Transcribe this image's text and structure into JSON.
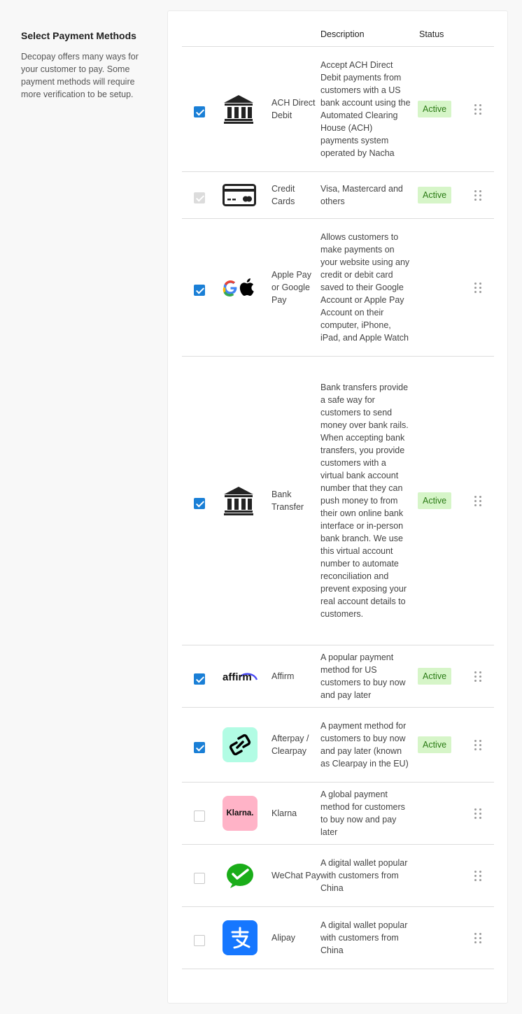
{
  "sidebar": {
    "title": "Select Payment Methods",
    "description": "Decopay offers many ways for your customer to pay. Some payment methods will require more verification to be setup."
  },
  "table": {
    "headers": {
      "description": "Description",
      "status": "Status"
    },
    "rows": [
      {
        "name": "ACH Direct Debit",
        "description": "Accept ACH Direct Debit payments from customers with a US bank account using the Automated Clearing House (ACH) payments system operated by Nacha",
        "status": "Active",
        "checked": true,
        "icon": "bank-icon"
      },
      {
        "name": "Credit Cards",
        "description": "Visa, Mastercard and others",
        "status": "Active",
        "checked": true,
        "disabled": true,
        "icon": "credit-card-icon"
      },
      {
        "name": "Apple Pay or Google Pay",
        "description": "Allows customers to make payments on your website using any credit or debit card saved to their Google Account or Apple Pay Account on their computer, iPhone, iPad, and Apple Watch",
        "status": "",
        "checked": true,
        "icon": "google-apple-icon"
      },
      {
        "name": "Bank Transfer",
        "description": "Bank transfers provide a safe way for customers to send money over bank rails. When accepting bank transfers, you provide customers with a virtual bank account number that they can push money to from their own online bank interface or in-person bank branch. We use this virtual account number to automate reconciliation and prevent exposing your real account details to customers.",
        "status": "Active",
        "checked": true,
        "icon": "bank-icon"
      },
      {
        "name": "Affirm",
        "description": "A popular payment method for US customers to buy now and pay later",
        "status": "Active",
        "checked": true,
        "icon": "affirm-logo",
        "logo_text": "affirm"
      },
      {
        "name": "Afterpay / Clearpay",
        "description": "A payment method for customers to buy now and pay later (known as Clearpay in the EU)",
        "status": "Active",
        "checked": true,
        "icon": "afterpay-logo"
      },
      {
        "name": "Klarna",
        "description": "A global payment method for customers to buy now and pay later",
        "status": "",
        "checked": false,
        "icon": "klarna-logo",
        "logo_text": "Klarna."
      },
      {
        "name": "WeChat Pay",
        "description": "A digital wallet popular with customers from China",
        "status": "",
        "checked": false,
        "icon": "wechat-pay-logo"
      },
      {
        "name": "Alipay",
        "description": "A digital wallet popular with customers from China",
        "status": "",
        "checked": false,
        "icon": "alipay-logo"
      }
    ]
  },
  "colors": {
    "accent": "#1a7fd6",
    "badge_bg": "#d6f5c8",
    "badge_text": "#2a7a14",
    "afterpay_bg": "#b2fce4",
    "klarna_bg": "#ffb3c7",
    "wechat_green": "#1aad19",
    "alipay_blue": "#1677ff"
  }
}
